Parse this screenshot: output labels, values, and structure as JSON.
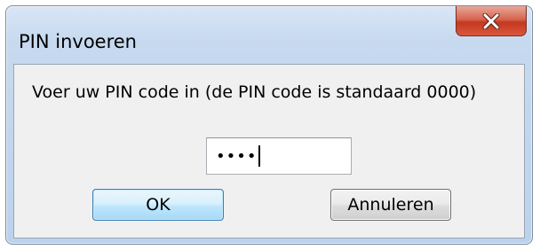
{
  "window": {
    "title": "PIN invoeren",
    "close_icon": "close-x-icon",
    "close_color": "#c4381f"
  },
  "dialog": {
    "prompt": "Voer uw PIN code in (de PIN code is standaard 0000)",
    "pin_masked_value": "••••",
    "ok_label": "OK",
    "cancel_label": "Annuleren"
  }
}
